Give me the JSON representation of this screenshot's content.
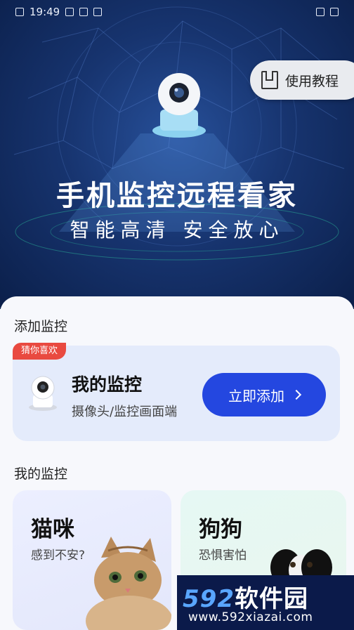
{
  "status_bar": {
    "time": "19:49"
  },
  "header": {
    "tutorial_label": "使用教程"
  },
  "hero": {
    "title": "手机监控远程看家",
    "subtitle": "智能高清  安全放心"
  },
  "add_section": {
    "title": "添加监控",
    "badge": "猜你喜欢",
    "card_title": "我的监控",
    "card_subtitle": "摄像头/监控画面端",
    "button_label": "立即添加"
  },
  "my_section": {
    "title": "我的监控",
    "cards": [
      {
        "title": "猫咪",
        "subtitle": "感到不安?"
      },
      {
        "title": "狗狗",
        "subtitle": "恐惧害怕"
      }
    ]
  },
  "watermark": {
    "brand_number": "592",
    "brand_text": "软件园",
    "url": "www.592xiazai.com"
  },
  "colors": {
    "accent": "#2447e0",
    "badge": "#e94a40",
    "hero_bg": "#17346f"
  }
}
